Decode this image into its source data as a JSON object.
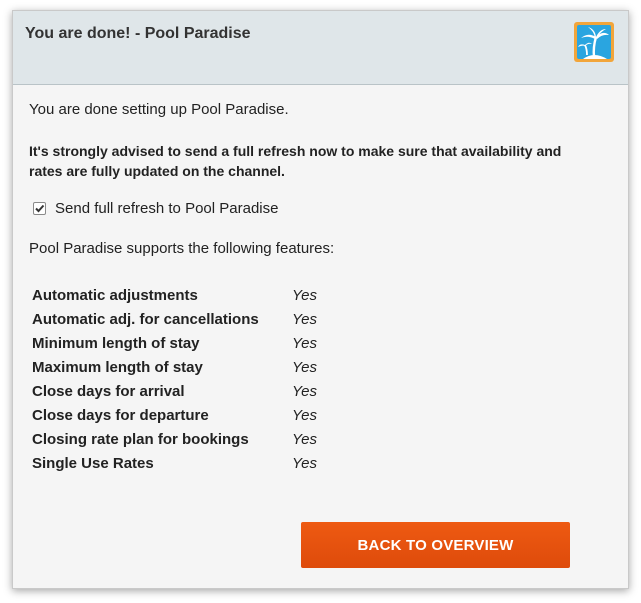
{
  "dialog": {
    "title": "You are done! - Pool Paradise",
    "logo_icon": "palm-tree-island-logo"
  },
  "content": {
    "intro": "You are done setting up Pool Paradise.",
    "advice": "It's strongly advised to send a full refresh now to make sure that availability and rates are fully updated on the channel.",
    "refresh_checkbox": {
      "label": "Send full refresh to Pool Paradise",
      "checked": true
    },
    "features_intro": "Pool Paradise supports the following features:",
    "features": [
      {
        "name": "Automatic adjustments",
        "value": "Yes"
      },
      {
        "name": "Automatic adj. for cancellations",
        "value": "Yes"
      },
      {
        "name": "Minimum length of stay",
        "value": "Yes"
      },
      {
        "name": "Maximum length of stay",
        "value": "Yes"
      },
      {
        "name": "Close days for arrival",
        "value": "Yes"
      },
      {
        "name": "Close days for departure",
        "value": "Yes"
      },
      {
        "name": "Closing rate plan for bookings",
        "value": "Yes"
      },
      {
        "name": "Single Use Rates",
        "value": "Yes"
      }
    ]
  },
  "actions": {
    "back_label": "BACK TO OVERVIEW"
  },
  "colors": {
    "header_bg": "#dfe6e9",
    "dialog_bg": "#f5f5f5",
    "button_bg": "#e8500f",
    "logo_orange": "#f2a53a",
    "logo_blue": "#2aa5e0"
  }
}
